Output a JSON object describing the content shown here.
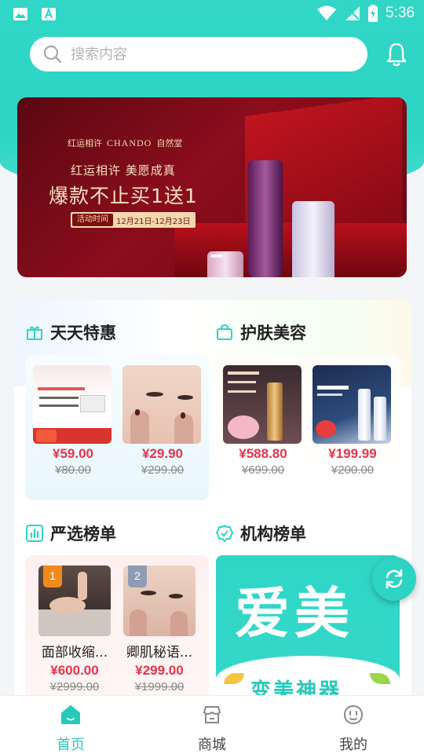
{
  "status_bar": {
    "time": "5:36"
  },
  "search": {
    "placeholder": "搜索内容"
  },
  "banner": {
    "brand_left": "红运相许",
    "brand_name": "CHANDO",
    "brand_cn": "自然堂",
    "slogan": "红运相许  美愿成真",
    "headline": "爆款不止买1送1",
    "date_tag": "活动时间",
    "date_range": "12月21日-12月23日"
  },
  "sections": {
    "daily_deals": {
      "title": "天天特惠",
      "items": [
        {
          "price": "¥59.00",
          "original": "¥80.00"
        },
        {
          "price": "¥29.90",
          "original": "¥299.00"
        }
      ]
    },
    "skincare": {
      "title": "护肤美容",
      "items": [
        {
          "price": "¥588.80",
          "original": "¥699.00"
        },
        {
          "price": "¥199.99",
          "original": "¥200.00"
        }
      ]
    },
    "selection_ranking": {
      "title": "严选榜单",
      "items": [
        {
          "rank": "1",
          "name": "面部收缩...",
          "price": "¥600.00",
          "original": "¥2999.00"
        },
        {
          "rank": "2",
          "name": "卿肌秘语...",
          "price": "¥299.00",
          "original": "¥1999.00"
        }
      ]
    },
    "org_ranking": {
      "title": "机构榜单",
      "banner_big": "爱美",
      "banner_sub": "变美神器"
    }
  },
  "tabbar": {
    "items": [
      {
        "label": "首页",
        "icon": "home-icon",
        "active": true
      },
      {
        "label": "商城",
        "icon": "shop-icon",
        "active": false
      },
      {
        "label": "我的",
        "icon": "profile-icon",
        "active": false
      }
    ]
  },
  "colors": {
    "accent": "#2dd4c4",
    "price_red": "#e8334a"
  }
}
